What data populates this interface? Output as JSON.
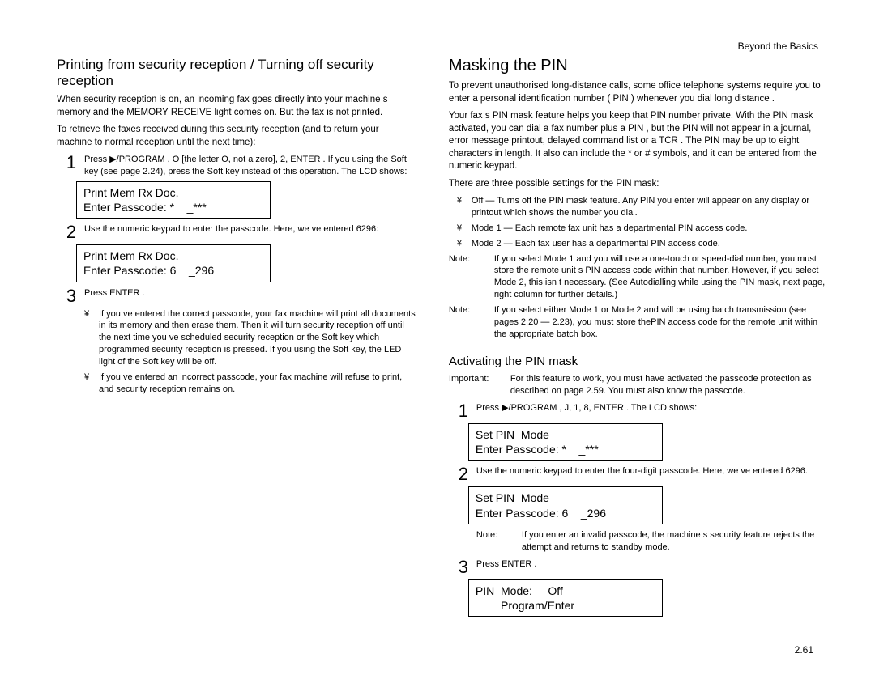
{
  "header": {
    "section": "Beyond the Basics"
  },
  "page_number": "2.61",
  "left": {
    "title": "Printing from security reception / Turning off security reception",
    "intro1": "When security reception is on, an incoming fax goes directly into your machine s memory and the  MEMORY RECEIVE  light comes on. But the fax is not printed.",
    "intro2": "To retrieve the faxes received during this security reception (and to return your machine to normal reception until the next time):",
    "step1": "Press ▶/PROGRAM , O [the letter  O, not a zero], 2, ENTER .\nIf you using the Soft key (see page 2.24), press the Soft key instead of this operation. The  LCD shows:",
    "lcd1_line1": "Print Mem Rx Doc.",
    "lcd1_line2": "Enter Passcode: *    _***",
    "step2": "Use the numeric keypad to enter the passcode. Here, we ve entered  6296:",
    "lcd2_line1": "Print Mem Rx Doc.",
    "lcd2_line2": "Enter Passcode: 6    _296",
    "step3": "Press ENTER .",
    "bullet1": "If you ve entered the correct passcode, your fax machine will print all documents in its memory and then erase them. Then it will turn security reception off until the next time you ve scheduled security reception or the Soft key which programmed security reception is pressed. If you using the Soft key, the  LED light of the Soft key will be off.",
    "bullet2": "If you ve entered an incorrect passcode, your fax machine will refuse to print, and security reception remains on."
  },
  "right": {
    "title": "Masking the  PIN",
    "p1": "To prevent unauthorised long-distance calls, some office telephone systems require you to enter a  personal identification number ( PIN ) whenever you dial long distance .",
    "p2": "Your fax s  PIN mask feature  helps you keep that  PIN number private. With the  PIN mask activated, you can dial a fax number plus a  PIN , but the  PIN will not appear in a journal, error message printout, delayed command list or a  TCR . The PIN  may be up to eight characters in length. It also can include the  *  or # symbols, and it can be entered from the numeric keypad.",
    "p3": "There are three possible settings for the  PIN mask:",
    "opt1": "Off — Turns off the  PIN mask feature. Any  PIN you enter will appear on any display or printout which shows the number you dial.",
    "opt2": "Mode 1 — Each  remote fax unit  has a departmental  PIN access code.",
    "opt3": "Mode 2 — Each  fax user has a departmental  PIN access code.",
    "note1": "If you select Mode 1 and you will use a one-touch or speed-dial number, you must store the remote unit s  PIN access code within that number. However, if you select Mode 2, this isn t necessary. (See  Autodialling while using the  PIN mask,  next page, right column for further details.)",
    "note2": "If you select either Mode 1 or Mode 2 and will be using batch transmission (see pages 2.20 — 2.23), you must store thePIN  access code for the remote unit within the appropriate batch box.",
    "sub_title": "Activating the  PIN mask",
    "important": "For this feature to work, you must have activated the  passcode protection  as described on page 2.59. You must also know  the passcode.",
    "step1": "Press ▶/PROGRAM , J, 1, 8, ENTER . The  LCD shows:",
    "lcd1_line1": "Set PIN  Mode",
    "lcd1_line2": "Enter Passcode: *    _***",
    "step2": "Use the numeric keypad to enter the four-digit passcode. Here, we ve entered 6296.",
    "lcd2_line1": "Set PIN  Mode",
    "lcd2_line2": "Enter Passcode: 6    _296",
    "note3": "If you enter an invalid passcode, the machine s security feature rejects the attempt and returns to standby mode.",
    "step3": "Press ENTER .",
    "lcd3_line1": "PIN  Mode:     Off",
    "lcd3_line2": "        Program/Enter"
  }
}
